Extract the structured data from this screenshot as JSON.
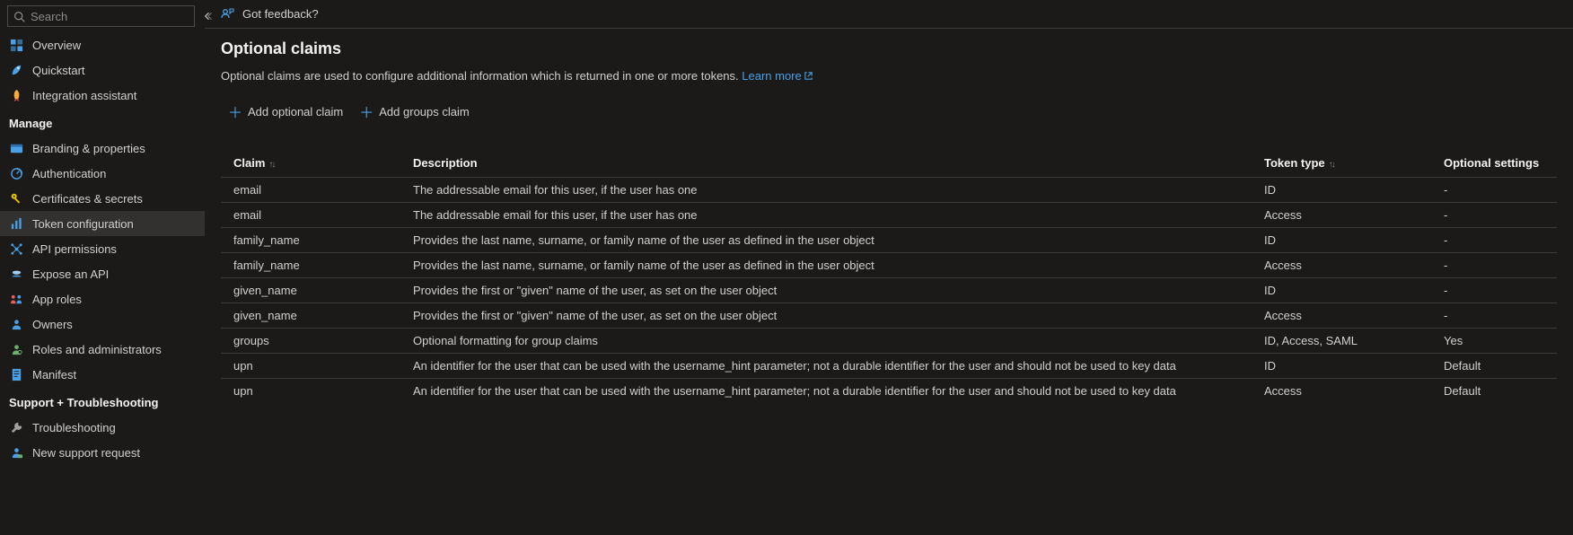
{
  "search": {
    "placeholder": "Search"
  },
  "feedback_link": "Got feedback?",
  "sidebar": {
    "top_items": [
      {
        "label": "Overview",
        "icon": "overview-icon",
        "color": "#4aa0e6"
      },
      {
        "label": "Quickstart",
        "icon": "quickstart-icon",
        "color": "#4aa0e6"
      },
      {
        "label": "Integration assistant",
        "icon": "rocket-icon",
        "color": "#f7a93b"
      }
    ],
    "sections": [
      {
        "header": "Manage",
        "items": [
          {
            "label": "Branding & properties",
            "icon": "branding-icon",
            "color": "#4aa0e6",
            "active": false
          },
          {
            "label": "Authentication",
            "icon": "auth-icon",
            "color": "#4aa0e6",
            "active": false
          },
          {
            "label": "Certificates & secrets",
            "icon": "key-icon",
            "color": "#f0c800",
            "active": false
          },
          {
            "label": "Token configuration",
            "icon": "token-icon",
            "color": "#4aa0e6",
            "active": true
          },
          {
            "label": "API permissions",
            "icon": "api-perm-icon",
            "color": "#4aa0e6",
            "active": false
          },
          {
            "label": "Expose an API",
            "icon": "expose-icon",
            "color": "#4aa0e6",
            "active": false
          },
          {
            "label": "App roles",
            "icon": "app-roles-icon",
            "color": "#e85f5f",
            "active": false
          },
          {
            "label": "Owners",
            "icon": "owners-icon",
            "color": "#4aa0e6",
            "active": false
          },
          {
            "label": "Roles and administrators",
            "icon": "roles-admin-icon",
            "color": "#6bb36b",
            "active": false
          },
          {
            "label": "Manifest",
            "icon": "manifest-icon",
            "color": "#4aa0e6",
            "active": false
          }
        ]
      },
      {
        "header": "Support + Troubleshooting",
        "items": [
          {
            "label": "Troubleshooting",
            "icon": "wrench-icon",
            "color": "#a0a0a0",
            "active": false
          },
          {
            "label": "New support request",
            "icon": "support-icon",
            "color": "#4aa0e6",
            "active": false
          }
        ]
      }
    ]
  },
  "page": {
    "title": "Optional claims",
    "description": "Optional claims are used to configure additional information which is returned in one or more tokens.",
    "learn_more": "Learn more",
    "actions": {
      "add_claim": "Add optional claim",
      "add_groups": "Add groups claim"
    }
  },
  "table": {
    "columns": {
      "claim": "Claim",
      "description": "Description",
      "token_type": "Token type",
      "optional_settings": "Optional settings"
    },
    "rows": [
      {
        "claim": "email",
        "description": "The addressable email for this user, if the user has one",
        "token_type": "ID",
        "optional_settings": "-"
      },
      {
        "claim": "email",
        "description": "The addressable email for this user, if the user has one",
        "token_type": "Access",
        "optional_settings": "-"
      },
      {
        "claim": "family_name",
        "description": "Provides the last name, surname, or family name of the user as defined in the user object",
        "token_type": "ID",
        "optional_settings": "-"
      },
      {
        "claim": "family_name",
        "description": "Provides the last name, surname, or family name of the user as defined in the user object",
        "token_type": "Access",
        "optional_settings": "-"
      },
      {
        "claim": "given_name",
        "description": "Provides the first or \"given\" name of the user, as set on the user object",
        "token_type": "ID",
        "optional_settings": "-"
      },
      {
        "claim": "given_name",
        "description": "Provides the first or \"given\" name of the user, as set on the user object",
        "token_type": "Access",
        "optional_settings": "-"
      },
      {
        "claim": "groups",
        "description": "Optional formatting for group claims",
        "token_type": "ID, Access, SAML",
        "optional_settings": "Yes"
      },
      {
        "claim": "upn",
        "description": "An identifier for the user that can be used with the username_hint parameter; not a durable identifier for the user and should not be used to key data",
        "token_type": "ID",
        "optional_settings": "Default"
      },
      {
        "claim": "upn",
        "description": "An identifier for the user that can be used with the username_hint parameter; not a durable identifier for the user and should not be used to key data",
        "token_type": "Access",
        "optional_settings": "Default"
      }
    ]
  }
}
